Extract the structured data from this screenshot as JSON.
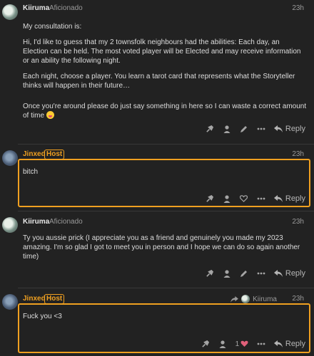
{
  "posts": [
    {
      "username": "Kiiruma",
      "title": "Aficionado",
      "time": "23h",
      "paragraphs": [
        "My consultation is:",
        "Hi, I'd like to guess that my 2 townsfolk neighbours had the abilities: Each day, an Election can be held. The most voted player will be Elected and may receive information or an ability the following night.",
        "Each night, choose a player. You learn a tarot card that represents what the Storyteller thinks will happen in their future…",
        "Once you're around please do just say something in here so I can waste a correct amount of time"
      ],
      "reply_label": "Reply"
    },
    {
      "username": "Jinxed",
      "badge": "Host",
      "time": "23h",
      "paragraphs": [
        "bitch"
      ],
      "reply_label": "Reply"
    },
    {
      "username": "Kiiruma",
      "title": "Aficionado",
      "time": "23h",
      "paragraphs": [
        "Ty you aussie prick (I appreciate you as a friend and genuinely you made my 2023 amazing. I'm so glad I got to meet you in person and I hope we can do so again another time)"
      ],
      "reply_label": "Reply"
    },
    {
      "username": "Jinxed",
      "badge": "Host",
      "reply_to": "Kiiruma",
      "time": "23h",
      "paragraphs": [
        "Fuck you <3"
      ],
      "like_count": "1",
      "reply_label": "Reply"
    }
  ],
  "colors": {
    "host_accent": "#f0a020",
    "background": "#222222",
    "like_heart": "#e0607a"
  },
  "icons": [
    "wrench-icon",
    "user-icon",
    "pencil-icon",
    "more-icon",
    "reply-icon",
    "heart-icon",
    "reply-arrow-icon"
  ]
}
